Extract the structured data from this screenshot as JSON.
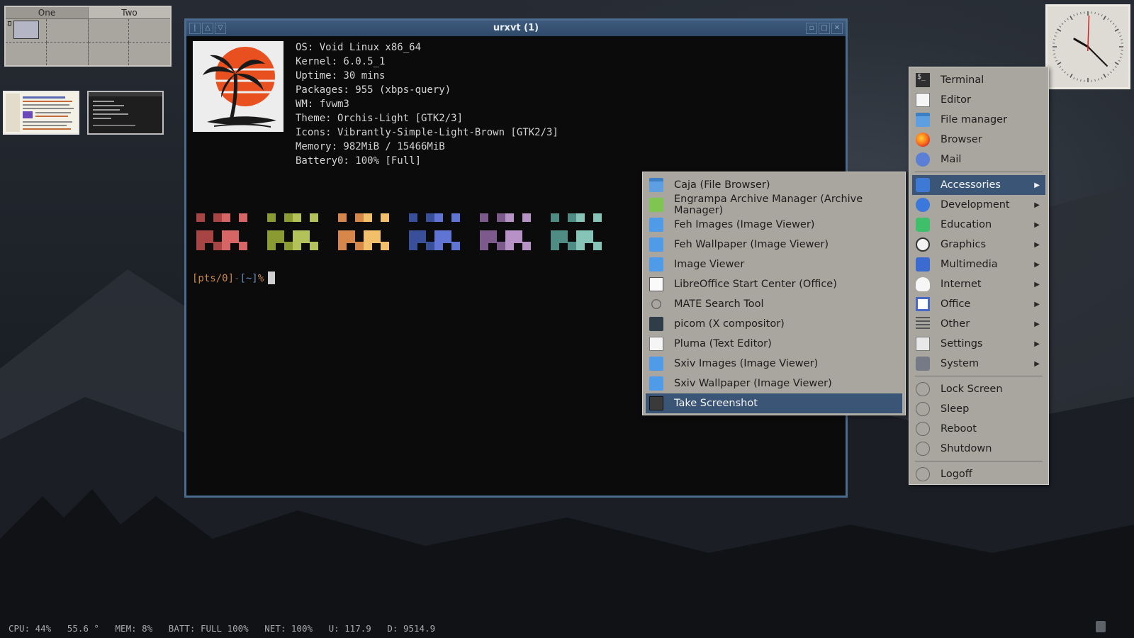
{
  "pager": {
    "desks": [
      "One",
      "Two"
    ]
  },
  "clock": {
    "hour_angle": 300,
    "minute_angle": 135,
    "second_angle": 2
  },
  "terminal": {
    "title": "urxvt (1)",
    "info": [
      "OS: Void Linux x86_64",
      "Kernel: 6.0.5_1",
      "Uptime: 30 mins",
      "Packages: 955 (xbps-query)",
      "WM: fvwm3",
      "Theme: Orchis-Light [GTK2/3]",
      "Icons: Vibrantly-Simple-Light-Brown [GTK2/3]",
      "Memory: 982MiB / 15466MiB",
      "Battery0: 100% [Full]"
    ],
    "prompt": {
      "pts": "[pts/0]",
      "dash": "-",
      "dir": "[~]",
      "symbol": "%"
    },
    "palette": [
      {
        "dark": "#a94444",
        "light": "#d66666"
      },
      {
        "dark": "#8c9a32",
        "light": "#b4c25a"
      },
      {
        "dark": "#d8874a",
        "light": "#f2c06a"
      },
      {
        "dark": "#3a4f9a",
        "light": "#6074d4"
      },
      {
        "dark": "#7d5a8c",
        "light": "#b692c6"
      },
      {
        "dark": "#4f8c84",
        "light": "#86c4b8"
      }
    ]
  },
  "root_menu": {
    "apps": [
      {
        "label": "Terminal",
        "icon": "terminal-icon",
        "cls": "ic-term"
      },
      {
        "label": "Editor",
        "icon": "text-editor-icon",
        "cls": "ic-editor"
      },
      {
        "label": "File manager",
        "icon": "folder-icon",
        "cls": "ic-folder"
      },
      {
        "label": "Browser",
        "icon": "firefox-icon",
        "cls": "ic-browser"
      },
      {
        "label": "Mail",
        "icon": "mail-icon",
        "cls": "ic-mail"
      }
    ],
    "categories": [
      {
        "label": "Accessories",
        "icon": "accessories-icon",
        "cls": "ic-acc",
        "selected": true
      },
      {
        "label": "Development",
        "icon": "development-icon",
        "cls": "ic-dev"
      },
      {
        "label": "Education",
        "icon": "education-icon",
        "cls": "ic-edu"
      },
      {
        "label": "Graphics",
        "icon": "graphics-icon",
        "cls": "ic-gfx"
      },
      {
        "label": "Multimedia",
        "icon": "multimedia-icon",
        "cls": "ic-mm"
      },
      {
        "label": "Internet",
        "icon": "internet-cloud-icon",
        "cls": "ic-inet"
      },
      {
        "label": "Office",
        "icon": "office-icon",
        "cls": "ic-office"
      },
      {
        "label": "Other",
        "icon": "other-icon",
        "cls": "ic-other"
      },
      {
        "label": "Settings",
        "icon": "settings-icon",
        "cls": "ic-settings"
      },
      {
        "label": "System",
        "icon": "system-icon",
        "cls": "ic-system"
      }
    ],
    "session": [
      {
        "label": "Lock Screen",
        "icon": "lock-icon",
        "cls": "ic-lock"
      },
      {
        "label": "Sleep",
        "icon": "sleep-icon",
        "cls": "ic-sleep"
      },
      {
        "label": "Reboot",
        "icon": "reboot-icon",
        "cls": "ic-reboot"
      },
      {
        "label": "Shutdown",
        "icon": "shutdown-icon",
        "cls": "ic-shutdown"
      }
    ],
    "logoff": {
      "label": "Logoff",
      "icon": "logoff-icon",
      "cls": "ic-logoff"
    }
  },
  "accessories_menu": {
    "items": [
      {
        "label": "Caja (File Browser)",
        "icon": "folder-icon",
        "cls": "ic-folder"
      },
      {
        "label": "Engrampa Archive Manager (Archive Manager)",
        "icon": "archive-icon",
        "cls": "ic-arch"
      },
      {
        "label": "Feh Images (Image Viewer)",
        "icon": "image-viewer-icon",
        "cls": "ic-img"
      },
      {
        "label": "Feh Wallpaper (Image Viewer)",
        "icon": "image-viewer-icon",
        "cls": "ic-img"
      },
      {
        "label": "Image Viewer",
        "icon": "image-viewer-icon",
        "cls": "ic-img"
      },
      {
        "label": "LibreOffice Start Center (Office)",
        "icon": "document-icon",
        "cls": "ic-lo"
      },
      {
        "label": "MATE Search Tool",
        "icon": "search-icon",
        "cls": "ic-search"
      },
      {
        "label": "picom (X compositor)",
        "icon": "terminal-icon",
        "cls": "ic-picom"
      },
      {
        "label": "Pluma (Text Editor)",
        "icon": "text-editor-icon",
        "cls": "ic-editor"
      },
      {
        "label": "Sxiv Images (Image Viewer)",
        "icon": "image-viewer-icon",
        "cls": "ic-img"
      },
      {
        "label": "Sxiv Wallpaper (Image Viewer)",
        "icon": "image-viewer-icon",
        "cls": "ic-img"
      },
      {
        "label": "Take Screenshot",
        "icon": "screenshot-icon",
        "cls": "ic-shot",
        "selected": true
      }
    ]
  },
  "statusbar": {
    "cpu": "CPU: 44%",
    "temp": "55.6 °",
    "mem": "MEM: 8%",
    "batt": "BATT: FULL 100%",
    "net": "NET: 100%",
    "up": "U: 117.9",
    "down": "D: 9514.9"
  },
  "colors": {
    "menu_bg": "#a9a59f",
    "menu_selected": "#3b5576",
    "title_bar": "#3e5a7c",
    "prompt_orange": "#c88a4a",
    "prompt_blue": "#6a8cc0"
  }
}
